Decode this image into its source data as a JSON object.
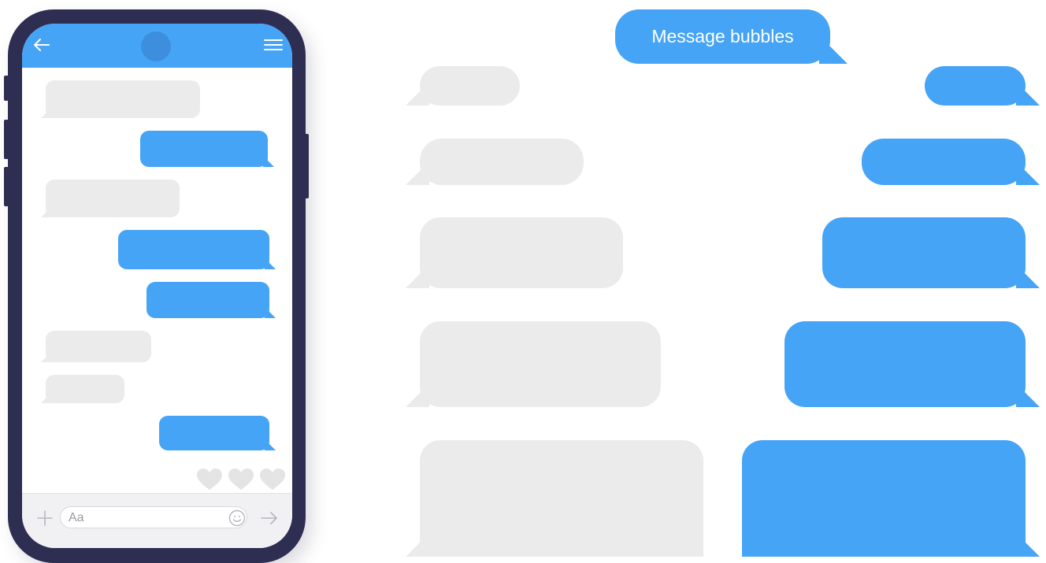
{
  "title_bubble": {
    "label": "Message bubbles"
  },
  "phone": {
    "input_placeholder": "Aa",
    "icons": [
      "back-arrow-icon",
      "hamburger-menu-icon",
      "plus-icon",
      "smiley-icon",
      "send-arrow-icon",
      "heart-icon"
    ]
  },
  "colors": {
    "accent": "#45a4f5",
    "incoming_bubble": "#ebebeb",
    "phone_frame": "#2e2d52",
    "heart": "#e4e4e4"
  }
}
